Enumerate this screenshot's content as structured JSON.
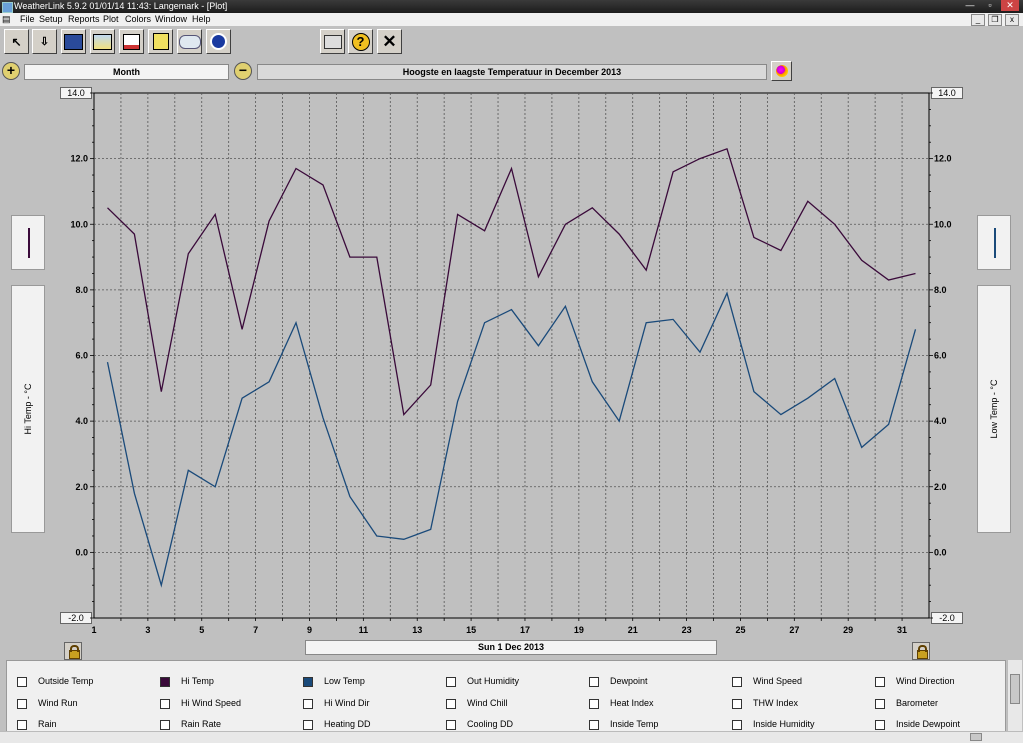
{
  "window": {
    "title": "WeatherLink 5.9.2  01/01/14  11:43: Langemark - [Plot]"
  },
  "menu": [
    "File",
    "Setup",
    "Reports",
    "Plot",
    "Colors",
    "Window",
    "Help"
  ],
  "controls": {
    "period": "Month",
    "plot_title": "Hoogste en laagste Temperatuur in December 2013",
    "date": "Sun 1 Dec 2013"
  },
  "colors": {
    "hi_temp": "#3a0a3a",
    "low_temp": "#1a4a7a",
    "grid": "#555555"
  },
  "chart_data": {
    "type": "line",
    "title": "Hoogste en laagste Temperatuur in December 2013",
    "xlabel": "",
    "ylabel_left": "Hi Temp - °C",
    "ylabel_right": "Low Temp - °C",
    "ylim": [
      -2.0,
      14.0
    ],
    "y_ticks": [
      "14.0",
      "12.0",
      "10.0",
      "8.0",
      "6.0",
      "4.0",
      "2.0",
      "0.0",
      "-2.0"
    ],
    "x_ticks": [
      "1",
      "3",
      "5",
      "7",
      "9",
      "11",
      "13",
      "15",
      "17",
      "19",
      "21",
      "23",
      "25",
      "27",
      "29",
      "31"
    ],
    "grid": true,
    "x": [
      1.5,
      2.5,
      3.5,
      4.5,
      5.5,
      6.5,
      7.5,
      8.5,
      9.5,
      10.5,
      11.5,
      12.5,
      13.5,
      14.5,
      15.5,
      16.5,
      17.5,
      18.5,
      19.5,
      20.5,
      21.5,
      22.5,
      23.5,
      24.5,
      25.5,
      26.5,
      27.5,
      28.5,
      29.5,
      30.5,
      31.5
    ],
    "series": [
      {
        "name": "Hi Temp",
        "values": [
          10.5,
          9.7,
          4.9,
          9.1,
          10.3,
          6.8,
          10.1,
          11.7,
          11.2,
          9.0,
          9.0,
          4.2,
          5.1,
          10.3,
          9.8,
          11.7,
          8.4,
          10.0,
          10.5,
          9.7,
          8.6,
          11.6,
          12.0,
          12.3,
          9.6,
          9.2,
          10.7,
          10.0,
          8.9,
          8.3,
          8.5
        ]
      },
      {
        "name": "Low Temp",
        "values": [
          5.8,
          1.8,
          -1.0,
          2.5,
          2.0,
          4.7,
          5.2,
          7.0,
          4.1,
          1.7,
          0.5,
          0.4,
          0.7,
          4.6,
          7.0,
          7.4,
          6.3,
          7.5,
          5.2,
          4.0,
          7.0,
          7.1,
          6.1,
          7.9,
          4.9,
          4.2,
          4.7,
          5.3,
          3.2,
          3.9,
          6.8
        ]
      }
    ]
  },
  "legend": {
    "rows": [
      [
        "Outside Temp",
        "Hi Temp",
        "Low Temp",
        "Out Humidity",
        "Dewpoint",
        "Wind Speed",
        "Wind Direction"
      ],
      [
        "Wind Run",
        "Hi Wind Speed",
        "Hi Wind Dir",
        "Wind Chill",
        "Heat Index",
        "THW Index",
        "Barometer"
      ],
      [
        "Rain",
        "Rain Rate",
        "Heating DD",
        "Cooling DD",
        "Inside Temp",
        "Inside Humidity",
        "Inside Dewpoint"
      ]
    ],
    "checked": {
      "Hi Temp": "#3a0a3a",
      "Low Temp": "#1a4a7a"
    }
  }
}
